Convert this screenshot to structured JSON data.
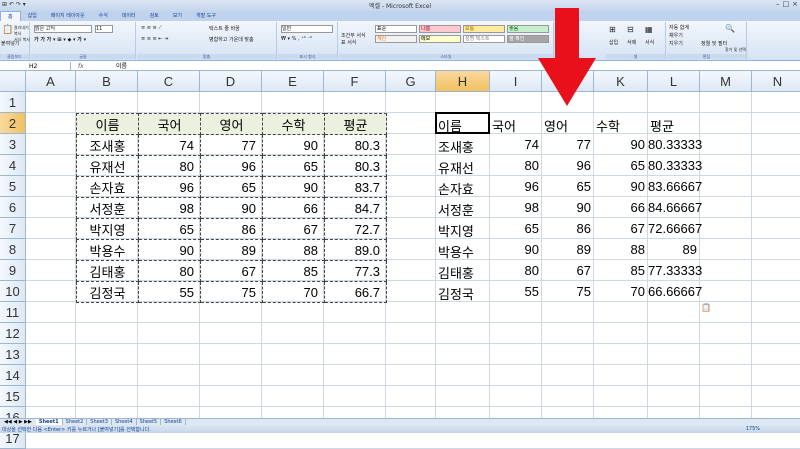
{
  "window": {
    "title": "엑셀 - Microsoft Excel",
    "qat": "⊞ ↶ ↷ ▾"
  },
  "tabs": [
    "홈",
    "삽입",
    "페이지 레이아웃",
    "수식",
    "데이터",
    "검토",
    "보기",
    "개발 도구"
  ],
  "ribbon": {
    "clipboard": {
      "label": "클립보드",
      "paste": "붙여넣기",
      "cut": "잘라내기",
      "copy": "복사",
      "format_painter": "서식 복사"
    },
    "font": {
      "label": "글꼴",
      "name": "맑은 고딕",
      "size": "11"
    },
    "alignment": {
      "label": "맞춤",
      "wrap": "텍스트 줄 바꿈",
      "merge": "병합하고 가운데 맞춤"
    },
    "number": {
      "label": "표시 형식",
      "format": "일반"
    },
    "styles": {
      "label": "스타일",
      "conditional": "조건부 서식",
      "table": "표 서식",
      "items": [
        {
          "text": "표준",
          "bg": "#ffffff",
          "color": "#000000"
        },
        {
          "text": "나쁨",
          "bg": "#ffc7ce",
          "color": "#9c0006"
        },
        {
          "text": "보통",
          "bg": "#ffeb9c",
          "color": "#9c6500"
        },
        {
          "text": "좋음",
          "bg": "#c6efce",
          "color": "#006100"
        },
        {
          "text": "계산",
          "bg": "#f2f2f2",
          "color": "#fa7d00"
        },
        {
          "text": "메모",
          "bg": "#ffffcc",
          "color": "#000000"
        },
        {
          "text": "설명 텍스트",
          "bg": "#ffffff",
          "color": "#7f7f7f"
        },
        {
          "text": "셀 확인",
          "bg": "#a5a5a5",
          "color": "#ffffff"
        }
      ]
    },
    "cells": {
      "label": "셀",
      "insert": "삽입",
      "delete": "삭제",
      "format": "서식"
    },
    "editing": {
      "label": "편집",
      "autosum": "자동 합계",
      "fill": "채우기",
      "clear": "지우기",
      "sort": "정렬 및 필터",
      "find": "찾기 및 선택"
    }
  },
  "formula_bar": {
    "name_box": "H2",
    "fx": "fx",
    "content": "이름"
  },
  "columns": [
    "A",
    "B",
    "C",
    "D",
    "E",
    "F",
    "G",
    "H",
    "I",
    "J",
    "K",
    "L",
    "M",
    "N"
  ],
  "rows": [
    "1",
    "2",
    "3",
    "4",
    "5",
    "6",
    "7",
    "8",
    "9",
    "10",
    "11",
    "12",
    "13",
    "14",
    "15",
    "16",
    "17"
  ],
  "source_table": {
    "headers": [
      "이름",
      "국어",
      "영어",
      "수학",
      "평균"
    ],
    "rows": [
      [
        "조새홍",
        "74",
        "77",
        "90",
        "80.3"
      ],
      [
        "유재선",
        "80",
        "96",
        "65",
        "80.3"
      ],
      [
        "손자효",
        "96",
        "65",
        "90",
        "83.7"
      ],
      [
        "서정훈",
        "98",
        "90",
        "66",
        "84.7"
      ],
      [
        "박지영",
        "65",
        "86",
        "67",
        "72.7"
      ],
      [
        "박용수",
        "90",
        "89",
        "88",
        "89.0"
      ],
      [
        "김태홍",
        "80",
        "67",
        "85",
        "77.3"
      ],
      [
        "김정국",
        "55",
        "75",
        "70",
        "66.7"
      ]
    ]
  },
  "pasted_table": {
    "headers": [
      "이름",
      "국어",
      "영어",
      "수학",
      "평균"
    ],
    "rows": [
      [
        "조새홍",
        "74",
        "77",
        "90",
        "80.33333"
      ],
      [
        "유재선",
        "80",
        "96",
        "65",
        "80.33333"
      ],
      [
        "손자효",
        "96",
        "65",
        "90",
        "83.66667"
      ],
      [
        "서정훈",
        "98",
        "90",
        "66",
        "84.66667"
      ],
      [
        "박지영",
        "65",
        "86",
        "67",
        "72.66667"
      ],
      [
        "박용수",
        "90",
        "89",
        "88",
        "89"
      ],
      [
        "김태홍",
        "80",
        "67",
        "85",
        "77.33333"
      ],
      [
        "김정국",
        "55",
        "75",
        "70",
        "66.66667"
      ]
    ]
  },
  "sheets": [
    "Sheet1",
    "Sheet2",
    "Sheet3",
    "Sheet4",
    "Sheet5",
    "Sheet6"
  ],
  "status": {
    "message": "대상을 선택한 다음 <Enter> 키를 누르거나 [붙여넣기]를 선택합니다.",
    "zoom": "175%"
  },
  "colors": {
    "arrow": "#e8101a",
    "header_fill": "#ebf1de"
  }
}
